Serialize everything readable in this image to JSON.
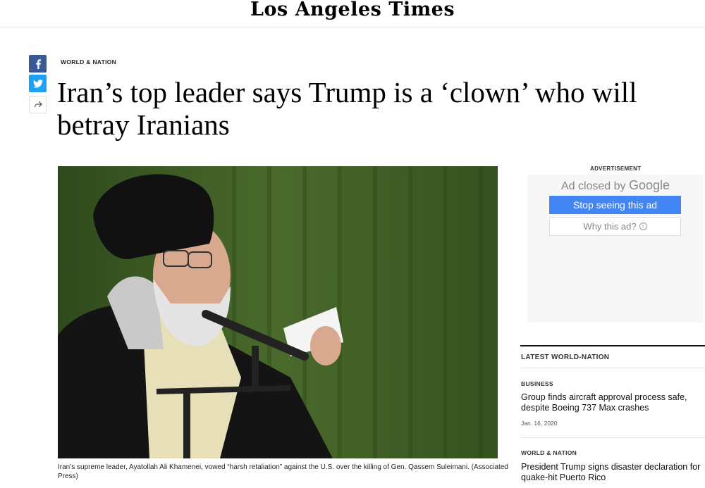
{
  "masthead": {
    "logo": "Los Angeles Times"
  },
  "share": {
    "facebook_icon": "facebook-icon",
    "twitter_icon": "twitter-icon",
    "share_icon": "share-arrow-icon"
  },
  "article": {
    "section": "WORLD & NATION",
    "headline": "Iran’s top leader says Trump is a ‘clown’ who will betray Iranians",
    "caption": "Iran’s supreme leader, Ayatollah Ali Khamenei, vowed “harsh retaliation” against the U.S. over the killing of Gen. Qassem Suleimani. (Associated Press)"
  },
  "ad": {
    "label": "ADVERTISEMENT",
    "closed_prefix": "Ad closed by",
    "closed_brand": "Google",
    "stop_button": "Stop seeing this ad",
    "why_button": "Why this ad?",
    "info_icon": "i"
  },
  "latest": {
    "label": "LATEST WORLD-NATION",
    "items": [
      {
        "category": "BUSINESS",
        "title": "Group finds aircraft approval process safe, despite Boeing 737 Max crashes",
        "date": "Jan. 16, 2020"
      },
      {
        "category": "WORLD & NATION",
        "title": "President Trump signs disaster declaration for quake-hit Puerto Rico",
        "date": ""
      }
    ]
  },
  "colors": {
    "facebook": "#3b5998",
    "twitter": "#1da1f2",
    "google_blue": "#4285f4",
    "photo_background": "#3f5a24"
  }
}
